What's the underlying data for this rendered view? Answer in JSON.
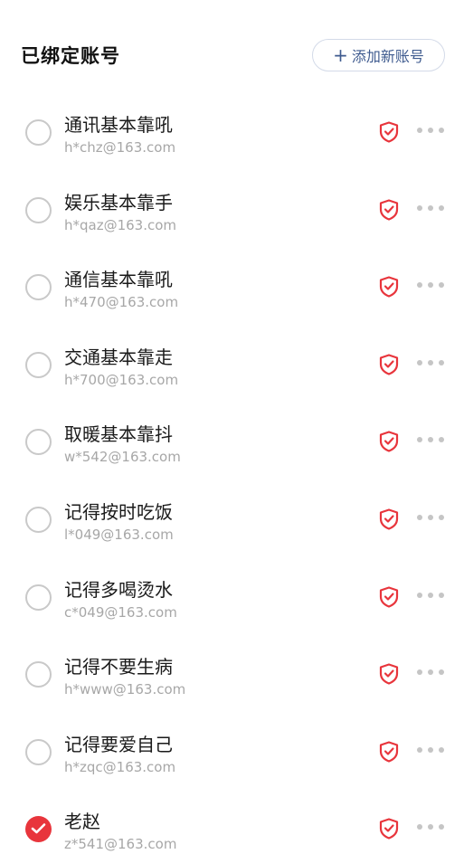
{
  "header": {
    "title": "已绑定账号",
    "add_button_label": "添加新账号",
    "add_icon": "plus-icon"
  },
  "colors": {
    "accent_red": "#e8353c",
    "button_text": "#3f5b8f",
    "secondary_text": "#a7a7a7"
  },
  "accounts": [
    {
      "name": "通讯基本靠吼",
      "email": "h*chz@163.com",
      "selected": false
    },
    {
      "name": "娱乐基本靠手",
      "email": "h*qaz@163.com",
      "selected": false
    },
    {
      "name": "通信基本靠吼",
      "email": "h*470@163.com",
      "selected": false
    },
    {
      "name": "交通基本靠走",
      "email": "h*700@163.com",
      "selected": false
    },
    {
      "name": "取暖基本靠抖",
      "email": "w*542@163.com",
      "selected": false
    },
    {
      "name": "记得按时吃饭",
      "email": "l*049@163.com",
      "selected": false
    },
    {
      "name": "记得多喝烫水",
      "email": "c*049@163.com",
      "selected": false
    },
    {
      "name": "记得不要生病",
      "email": "h*www@163.com",
      "selected": false
    },
    {
      "name": "记得要爱自己",
      "email": "h*zqc@163.com",
      "selected": false
    },
    {
      "name": "老赵",
      "email": "z*541@163.com",
      "selected": true
    }
  ],
  "row_icons": {
    "security": "shield-check-icon",
    "more": "more-dots-icon"
  }
}
